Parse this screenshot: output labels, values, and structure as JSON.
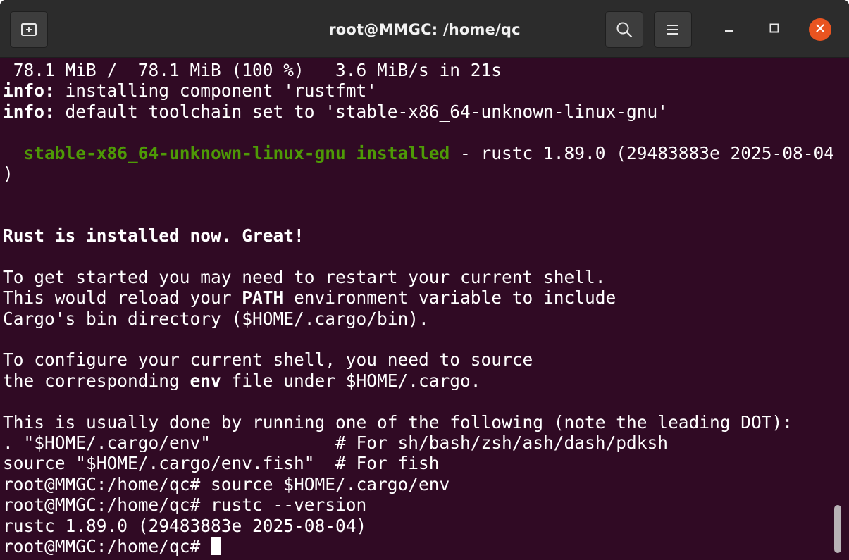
{
  "window": {
    "title": "root@MMGC: /home/qc"
  },
  "titlebar": {
    "new_tab_icon": "new-tab-icon",
    "search_icon": "search-icon",
    "menu_icon": "hamburger-menu-icon",
    "minimize_icon": "minimize-icon",
    "maximize_icon": "maximize-icon",
    "close_icon": "close-icon"
  },
  "colors": {
    "terminal_bg": "#300a24",
    "titlebar_bg": "#2c2c2c",
    "text": "#ffffff",
    "green": "#4e9a06",
    "close_button": "#e95420"
  },
  "terminal": {
    "lines": [
      " 78.1 MiB /  78.1 MiB (100 %)   3.6 MiB/s in 21s",
      "info: installing component 'rustfmt'",
      "info: default toolchain set to 'stable-x86_64-unknown-linux-gnu'",
      "",
      "  stable-x86_64-unknown-linux-gnu installed - rustc 1.89.0 (29483883e 2025-08-04",
      ")",
      "",
      "",
      "Rust is installed now. Great!",
      "",
      "To get started you may need to restart your current shell.",
      "This would reload your PATH environment variable to include",
      "Cargo's bin directory ($HOME/.cargo/bin).",
      "",
      "To configure your current shell, you need to source",
      "the corresponding env file under $HOME/.cargo.",
      "",
      "This is usually done by running one of the following (note the leading DOT):",
      ". \"$HOME/.cargo/env\"            # For sh/bash/zsh/ash/dash/pdksh",
      "source \"$HOME/.cargo/env.fish\"  # For fish",
      "root@MMGC:/home/qc# source $HOME/.cargo/env",
      "root@MMGC:/home/qc# rustc --version",
      "rustc 1.89.0 (29483883e 2025-08-04)",
      "root@MMGC:/home/qc# "
    ],
    "segments": {
      "l1_info": "info:",
      "l1_rest": " installing component 'rustfmt'",
      "l2_info": "info:",
      "l2_rest": " default toolchain set to 'stable-x86_64-unknown-linux-gnu'",
      "l4_indent": "  ",
      "l4_green": "stable-x86_64-unknown-linux-gnu installed",
      "l4_rest": " - rustc 1.89.0 (29483883e 2025-08-04",
      "l11_pre": "This would reload your ",
      "l11_bold": "PATH",
      "l11_post": " environment variable to include",
      "l15_pre": "the corresponding ",
      "l15_bold": "env",
      "l15_post": " file under $HOME/.cargo."
    },
    "prompt": "root@MMGC:/home/qc# "
  }
}
